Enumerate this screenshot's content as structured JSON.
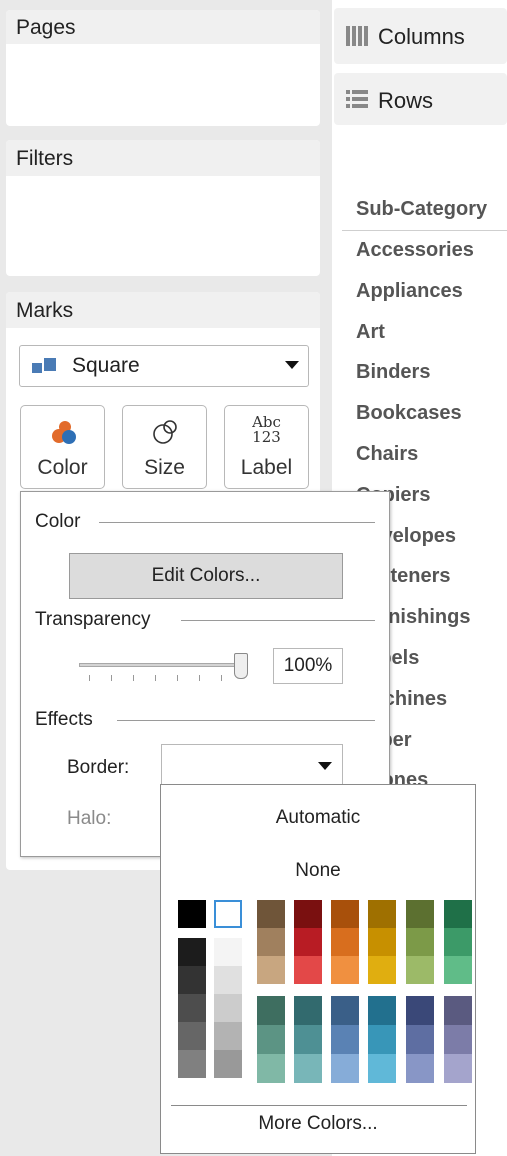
{
  "panels": {
    "pages_title": "Pages",
    "filters_title": "Filters",
    "marks_title": "Marks"
  },
  "shelves": {
    "columns_label": "Columns",
    "rows_label": "Rows"
  },
  "marks": {
    "type_selected": "Square",
    "buttons": {
      "color": "Color",
      "size": "Size",
      "label": "Label"
    },
    "label_icon_text": {
      "line1": "Abc",
      "line2": "123"
    }
  },
  "view": {
    "header": "Sub-Category",
    "items": [
      "Accessories",
      "Appliances",
      "Art",
      "Binders",
      "Bookcases",
      "Chairs",
      "Copiers",
      "Envelopes",
      "Fasteners",
      "Furnishings",
      "Labels",
      "Machines",
      "Paper",
      "Phones"
    ]
  },
  "color_popup": {
    "color_section": "Color",
    "edit_colors_button": "Edit Colors...",
    "transparency_section": "Transparency",
    "transparency_value": "100%",
    "transparency_level": 1.0,
    "effects_section": "Effects",
    "border_label": "Border:",
    "halo_label": "Halo:"
  },
  "border_dropdown": {
    "automatic": "Automatic",
    "none": "None",
    "more_colors": "More Colors...",
    "basic_colors": [
      "#000000",
      "#ffffff"
    ],
    "gray_dark_column": [
      "#1c1c1c",
      "#333333",
      "#4d4d4d",
      "#666666",
      "#808080"
    ],
    "gray_light_column": [
      "#f4f4f4",
      "#e0e0e0",
      "#cccccc",
      "#b3b3b3",
      "#999999"
    ],
    "top_palette_columns": [
      [
        "#6f5539",
        "#a0805e",
        "#c8a680"
      ],
      [
        "#7a1010",
        "#b81c24",
        "#e34848"
      ],
      [
        "#a8500b",
        "#d86e1e",
        "#f09040"
      ],
      [
        "#9f7000",
        "#c79000",
        "#e0ae10"
      ],
      [
        "#5c7030",
        "#7c9a48",
        "#9cba68"
      ],
      [
        "#1f7048",
        "#3c9a68",
        "#60bc88"
      ]
    ],
    "bottom_palette_columns": [
      [
        "#3e6e60",
        "#5c9484",
        "#80b8a6"
      ],
      [
        "#326a6e",
        "#4e9094",
        "#78b6b8"
      ],
      [
        "#3a5f88",
        "#5a82b4",
        "#86acd8"
      ],
      [
        "#22708e",
        "#3896b8",
        "#60b8d8"
      ],
      [
        "#3a4878",
        "#5e6ea2",
        "#8896c6"
      ],
      [
        "#5a5a80",
        "#7c7ca8",
        "#a4a4cc"
      ]
    ]
  }
}
